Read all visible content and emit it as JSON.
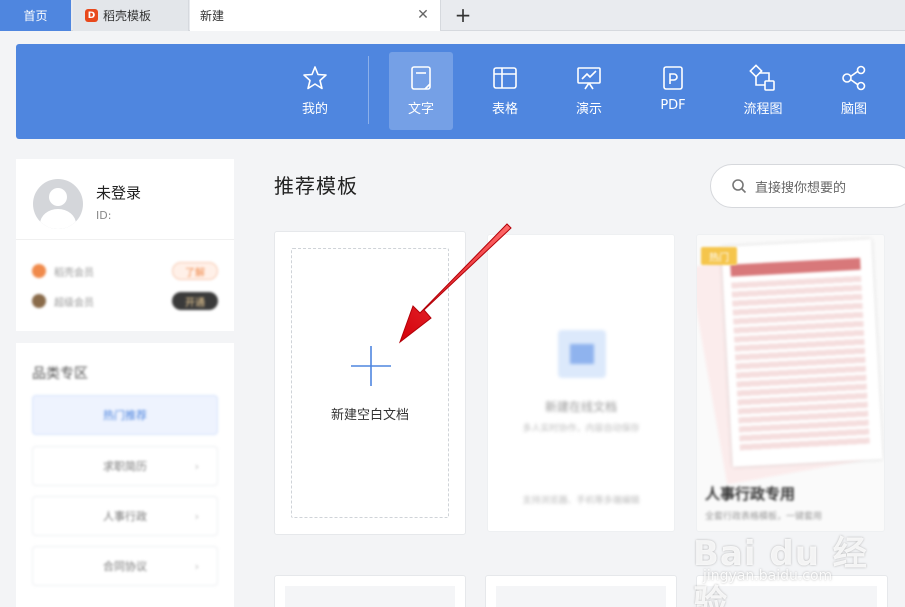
{
  "tabs": {
    "home": "首页",
    "docer": "稻壳模板",
    "docer_logo_char": "D",
    "new": "新建",
    "close_glyph": "✕",
    "add_glyph": "+"
  },
  "nav": {
    "items": [
      {
        "label": "我的",
        "icon": "star-icon"
      },
      {
        "label": "文字",
        "icon": "document-icon",
        "active": true
      },
      {
        "label": "表格",
        "icon": "spreadsheet-icon"
      },
      {
        "label": "演示",
        "icon": "presentation-icon"
      },
      {
        "label": "PDF",
        "icon": "pdf-icon"
      },
      {
        "label": "流程图",
        "icon": "flowchart-icon"
      },
      {
        "label": "脑图",
        "icon": "mindmap-icon"
      }
    ],
    "accent_color": "#4f86df"
  },
  "user": {
    "name": "未登录",
    "id_label": "ID:",
    "member_rows": [
      {
        "label": "稻壳会员",
        "badge": "了解",
        "color": "#f08a4b"
      },
      {
        "label": "超级会员",
        "badge": "开通",
        "color": "#8a6b4a"
      }
    ]
  },
  "zone": {
    "title": "品类专区",
    "items": [
      "热门推荐",
      "求职简历",
      "人事行政",
      "合同协议"
    ]
  },
  "main": {
    "section_title": "推荐模板",
    "search_placeholder": "直接搜你想要的",
    "new_blank_label": "新建空白文档",
    "template_card": {
      "title": "新建在线文档",
      "subtitle": "多人实时协作，内容自动保存",
      "footer": "支持浏览器、手机等多端编辑"
    },
    "sheet_card": {
      "tag": "热门",
      "title": "人事行政专用",
      "subtitle": "全套行政表格模板，一键套用"
    }
  },
  "watermark": {
    "main": "Bai du 经验",
    "sub": "jingyan.baidu.com"
  }
}
